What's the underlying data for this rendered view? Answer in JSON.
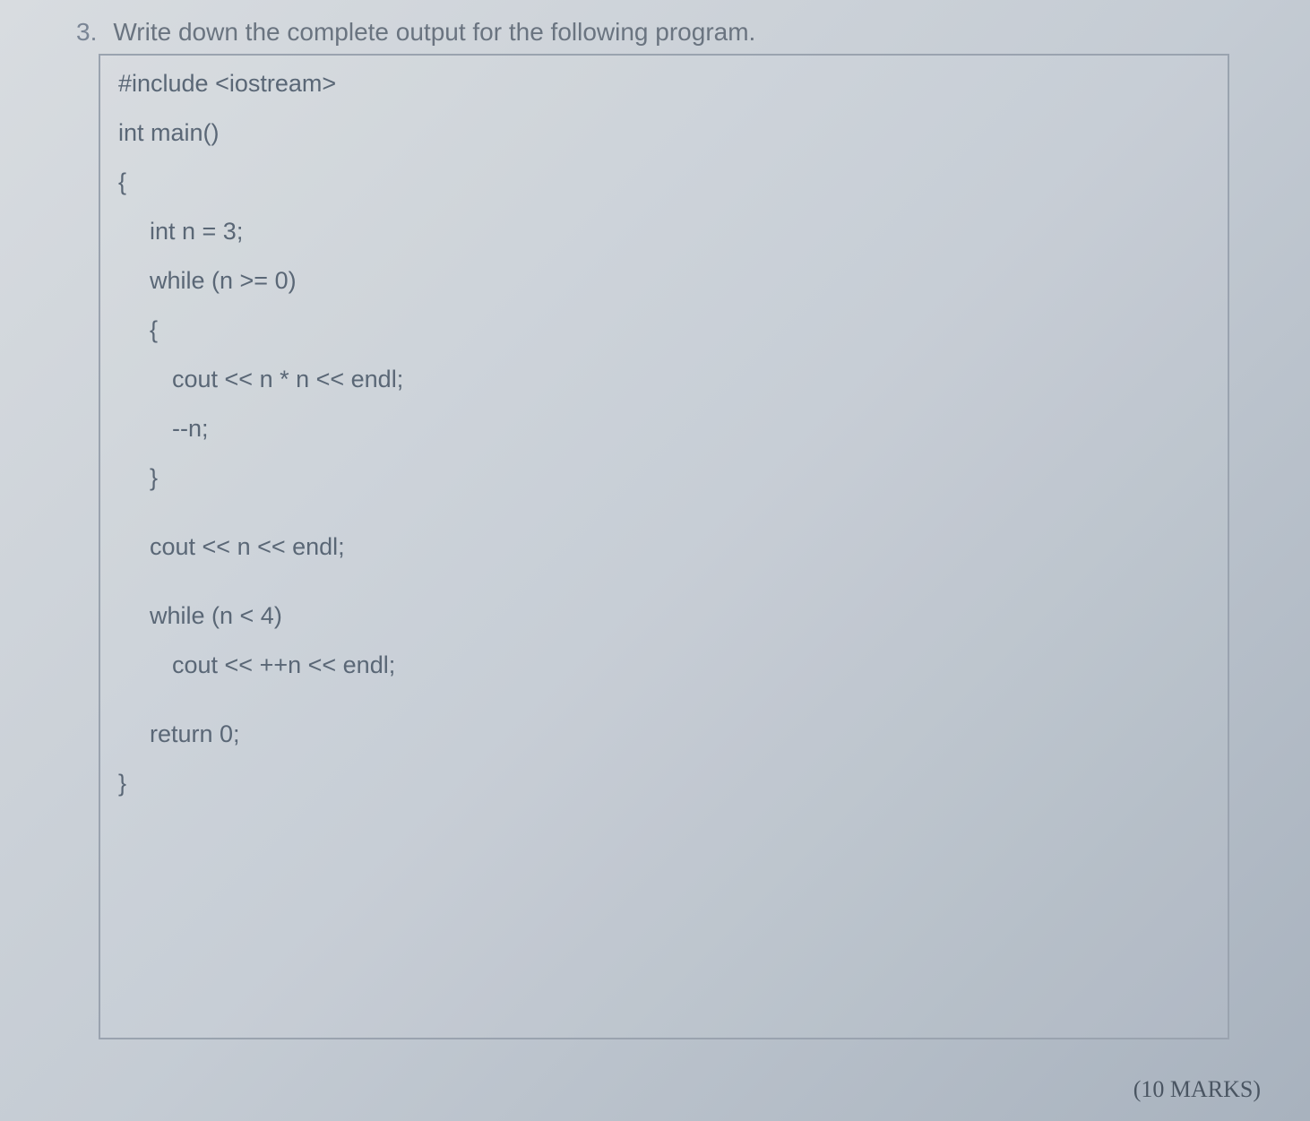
{
  "question": {
    "number": "3.",
    "text": "Write down the complete output for the following program."
  },
  "code": {
    "lines": [
      {
        "text": "#include <iostream>",
        "indent": 0,
        "gap": false
      },
      {
        "text": "int main()",
        "indent": 0,
        "gap": false
      },
      {
        "text": "{",
        "indent": 0,
        "gap": false
      },
      {
        "text": "int n = 3;",
        "indent": 1,
        "gap": false
      },
      {
        "text": "while (n >= 0)",
        "indent": 1,
        "gap": false
      },
      {
        "text": "{",
        "indent": 1,
        "gap": false
      },
      {
        "text": "cout << n * n << endl;",
        "indent": 2,
        "gap": false
      },
      {
        "text": "--n;",
        "indent": 2,
        "gap": false
      },
      {
        "text": "}",
        "indent": 1,
        "gap": false
      },
      {
        "text": "cout << n << endl;",
        "indent": 1,
        "gap": true
      },
      {
        "text": "while (n < 4)",
        "indent": 1,
        "gap": true
      },
      {
        "text": "cout << ++n << endl;",
        "indent": 2,
        "gap": false
      },
      {
        "text": "return 0;",
        "indent": 1,
        "gap": true
      },
      {
        "text": "}",
        "indent": 0,
        "gap": false
      }
    ]
  },
  "marks": "(10 MARKS)"
}
